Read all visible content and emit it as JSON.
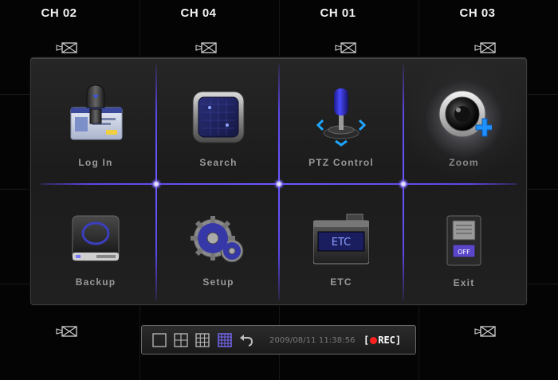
{
  "channels": [
    {
      "label": "CH 02"
    },
    {
      "label": "CH 04"
    },
    {
      "label": "CH 01"
    },
    {
      "label": "CH 03"
    }
  ],
  "menu": {
    "items": [
      {
        "label": "Log In",
        "icon": "login-card-icon"
      },
      {
        "label": "Search",
        "icon": "search-panel-icon"
      },
      {
        "label": "PTZ Control",
        "icon": "joystick-icon"
      },
      {
        "label": "Zoom",
        "icon": "camera-zoom-icon",
        "selected": true
      },
      {
        "label": "Backup",
        "icon": "backup-drive-icon"
      },
      {
        "label": "Setup",
        "icon": "gears-icon"
      },
      {
        "label": "ETC",
        "icon": "etc-box-icon",
        "icon_text": "ETC"
      },
      {
        "label": "Exit",
        "icon": "power-switch-icon",
        "icon_text": "OFF"
      }
    ]
  },
  "toolbar": {
    "timestamp": "2009/08/11  11:38:56",
    "rec_open": "[",
    "rec_text": "REC]",
    "active_layout": "16-split"
  },
  "colors": {
    "accent": "#6a58ff",
    "rec": "#ff2020",
    "background": "#040404"
  }
}
